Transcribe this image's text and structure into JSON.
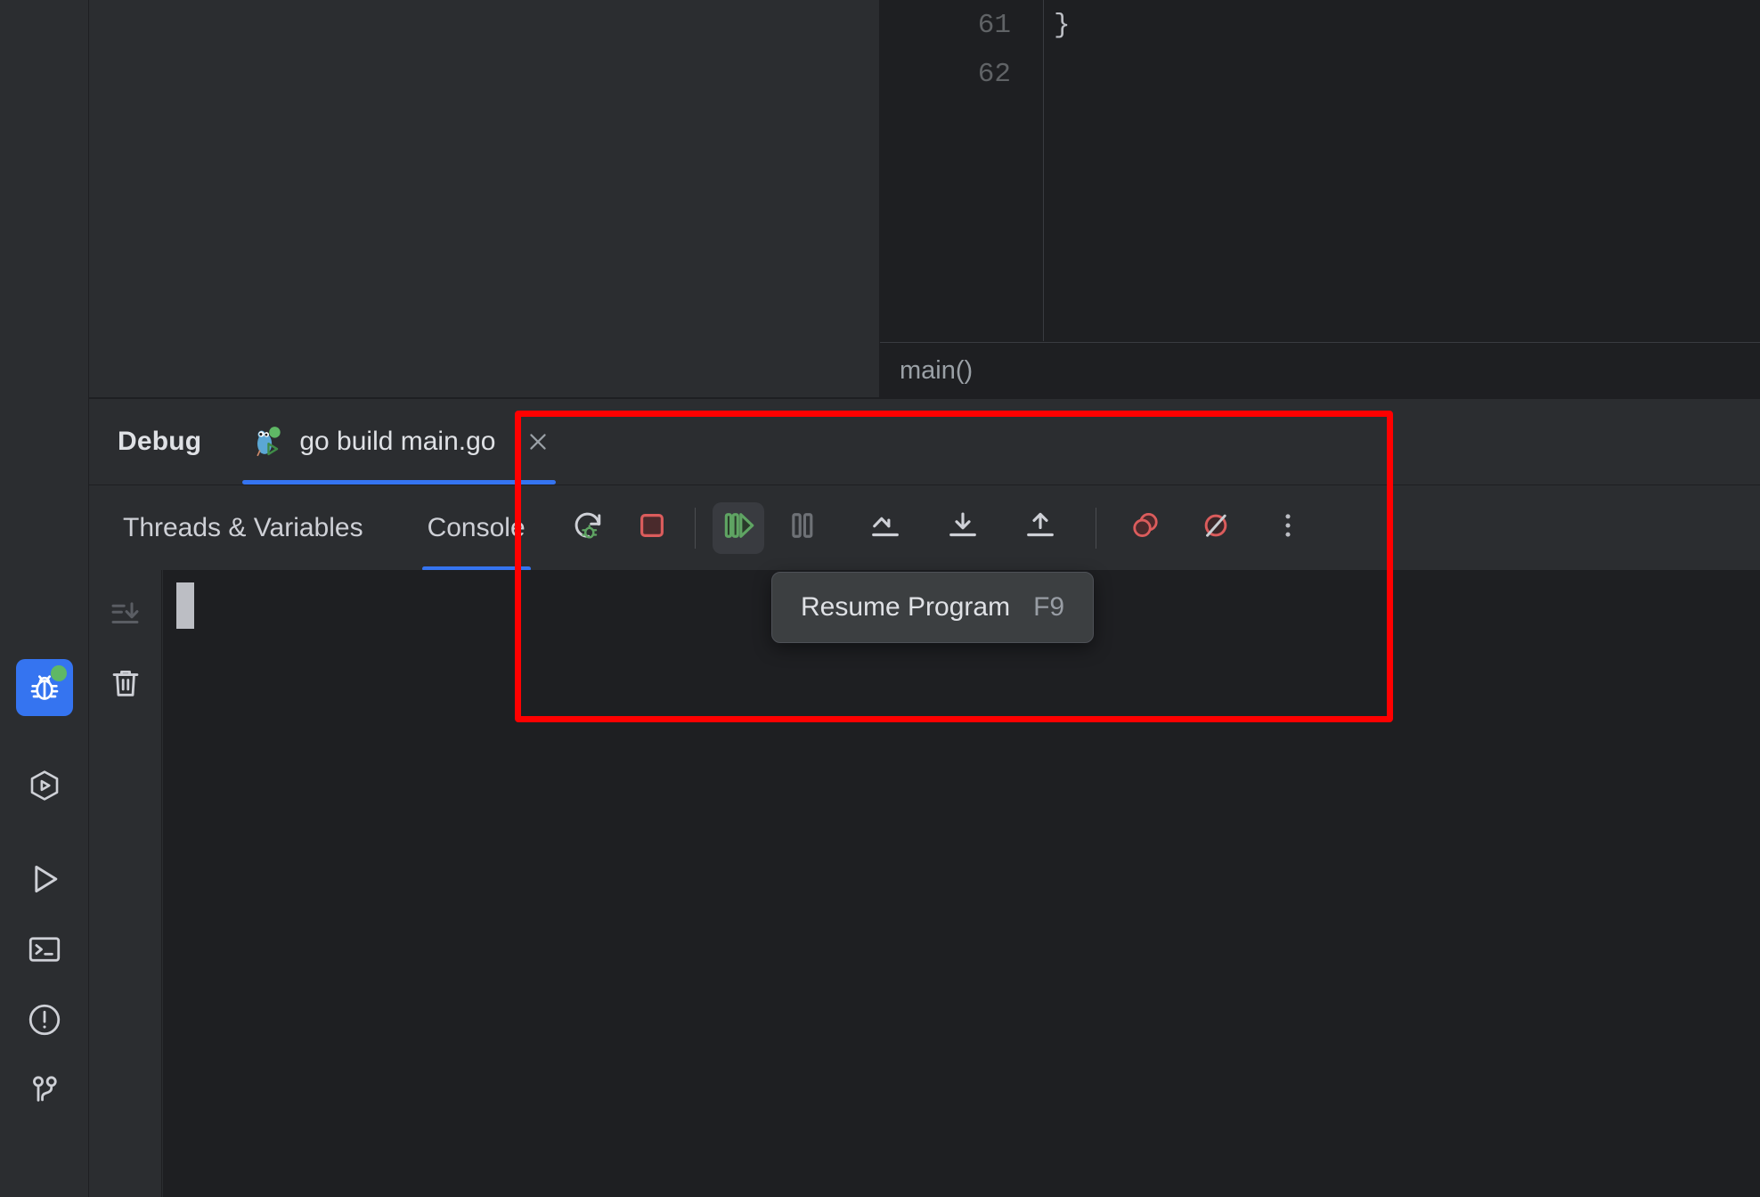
{
  "activity_bar": {
    "items": [
      {
        "name": "debug",
        "icon": "bug-icon",
        "active": true,
        "badge": true
      },
      {
        "name": "services",
        "icon": "services-icon",
        "active": false,
        "badge": false
      },
      {
        "name": "run",
        "icon": "run-icon",
        "active": false,
        "badge": false
      },
      {
        "name": "terminal",
        "icon": "terminal-icon",
        "active": false,
        "badge": false
      },
      {
        "name": "problems",
        "icon": "problems-icon",
        "active": false,
        "badge": false
      },
      {
        "name": "version-control",
        "icon": "git-branch-icon",
        "active": false,
        "badge": false
      }
    ]
  },
  "editor": {
    "lines": [
      {
        "number": "61",
        "text": "}"
      },
      {
        "number": "62",
        "text": ""
      }
    ],
    "breadcrumb": "main()"
  },
  "debug": {
    "title": "Debug",
    "run_tab": {
      "label": "go build main.go",
      "icon": "go-gopher-icon",
      "close_icon": "close-icon",
      "active": true
    },
    "tabs": [
      {
        "label": "Threads & Variables",
        "active": false
      },
      {
        "label": "Console",
        "active": true
      }
    ],
    "toolbar": [
      {
        "name": "rerun-debug",
        "icon": "rerun-debug-icon",
        "hovered": false
      },
      {
        "name": "stop",
        "icon": "stop-icon",
        "hovered": false
      },
      {
        "name": "separator",
        "icon": "separator",
        "hovered": false
      },
      {
        "name": "resume-program",
        "icon": "resume-icon",
        "hovered": true
      },
      {
        "name": "pause-program",
        "icon": "pause-icon",
        "hovered": false
      },
      {
        "name": "step-over",
        "icon": "step-over-icon",
        "hovered": false
      },
      {
        "name": "step-into",
        "icon": "step-into-icon",
        "hovered": false
      },
      {
        "name": "step-out",
        "icon": "step-out-icon",
        "hovered": false
      },
      {
        "name": "separator",
        "icon": "separator",
        "hovered": false
      },
      {
        "name": "view-breakpoints",
        "icon": "view-breakpoints-icon",
        "hovered": false
      },
      {
        "name": "mute-breakpoints",
        "icon": "mute-breakpoints-icon",
        "hovered": false
      },
      {
        "name": "more-options",
        "icon": "more-vertical-icon",
        "hovered": false
      }
    ],
    "console_gutter": [
      {
        "name": "scroll-to-end",
        "icon": "scroll-to-end-icon",
        "disabled": true
      },
      {
        "name": "clear-all",
        "icon": "trash-icon",
        "disabled": false
      }
    ]
  },
  "tooltip": {
    "text": "Resume Program",
    "shortcut": "F9"
  },
  "annotation": {
    "color": "#ff0000"
  },
  "colors": {
    "panel_bg": "#2b2d30",
    "editor_bg": "#1e1f22",
    "accent_blue": "#3574f0",
    "text_primary": "#dfe1e5",
    "text_muted": "#9aa0a6",
    "green": "#599e5e",
    "red": "#db5c5c",
    "annotation_red": "#ff0000"
  }
}
